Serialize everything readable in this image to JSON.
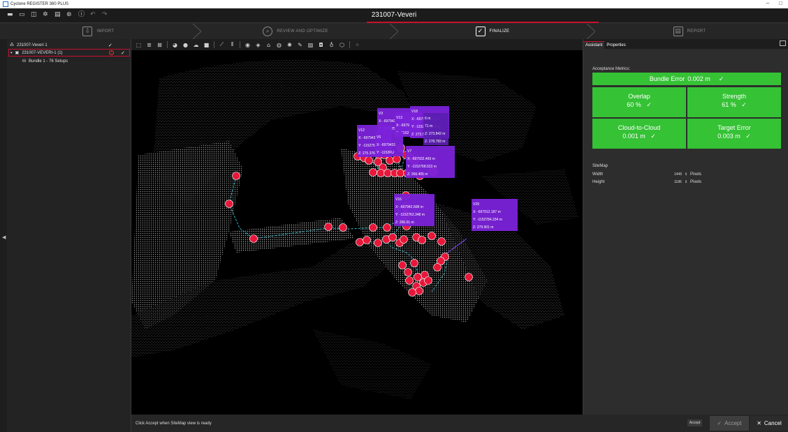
{
  "app": {
    "title": "Cyclone REGISTER 360 PLUS",
    "project_name": "231007-Veveri"
  },
  "window_controls": {
    "minimize": "–",
    "maximize": "□"
  },
  "workflow_steps": [
    {
      "label": "IMPORT",
      "icon": "import-icon",
      "active": false
    },
    {
      "label": "REVIEW AND OPTIMIZE",
      "icon": "search-optimize-icon",
      "active": false
    },
    {
      "label": "FINALIZE",
      "icon": "finalize-check-icon",
      "active": true
    },
    {
      "label": "REPORT",
      "icon": "report-icon",
      "active": false
    }
  ],
  "tree": {
    "root": {
      "label": "231007-Veveri 1",
      "checked": "✓"
    },
    "child": {
      "label": "231007-VEVERI-1 (1)",
      "checked": "✓",
      "warning": "!"
    },
    "bundle": {
      "label": "Bundle 1 - 76 Setups"
    }
  },
  "right_panel": {
    "tabs": [
      "Assistant",
      "Properties"
    ],
    "metrics_label": "Acceptance Metrics:",
    "bundle_error": {
      "label": "Bundle Error",
      "value": "0.002 m",
      "check": "✓"
    },
    "tiles": [
      {
        "label": "Overlap",
        "value": "60 %",
        "check": "✓"
      },
      {
        "label": "Strength",
        "value": "61 %",
        "check": "✓"
      },
      {
        "label": "Cloud-to-Cloud",
        "value": "0.001 m",
        "check": "✓"
      },
      {
        "label": "Target Error",
        "value": "0.003 m",
        "check": "✓"
      }
    ],
    "sitemap_label": "SiteMap",
    "width": {
      "label": "Width",
      "value": "1446",
      "unit": "Pixels"
    },
    "height": {
      "label": "Height",
      "value": "1186",
      "unit": "Pixels"
    },
    "accent_color": "#35c235"
  },
  "status": {
    "message": "Click Accept when SiteMap view is ready"
  },
  "buttons": {
    "accept_small": "Accept",
    "accept": "Accept",
    "accept_icon": "✓",
    "cancel": "Cancel",
    "cancel_icon": "✕"
  },
  "viewport_labels": [
    {
      "id": "V3",
      "lines": [
        "V3",
        "X: -697942",
        "Y: -115275"
      ]
    },
    {
      "id": "V13",
      "lines": [
        "V13",
        "X: -6979",
        "Y: -1152"
      ]
    },
    {
      "id": "V18",
      "lines": [
        "V18",
        "X: -697932.175 m",
        "Y: -1152754.348 m",
        "Z: 273.594 m"
      ]
    },
    {
      "id": "V12",
      "lines": [
        "V12",
        "X: -697943",
        "Y: -115275",
        "Z: 275.376"
      ]
    },
    {
      "id": "V5",
      "lines": [
        "V5",
        "X: -6979431",
        "Y: -1152FU"
      ]
    },
    {
      "id": "V7",
      "lines": [
        "V7",
        "X: -697932.469 m",
        "Y: -1152768.523 m",
        "Z: 266.405 m"
      ]
    },
    {
      "id": "V16",
      "lines": [
        "V16",
        "X: -697942.508 m",
        "Y: -1152762.348 m",
        "Z: 266.01 m"
      ]
    },
    {
      "id": "V29",
      "lines": [
        "V29",
        "X: -697912.187 m",
        "Y: -1152784.234 m",
        "Z: 279.901 m"
      ]
    },
    {
      "id": "extra",
      "lines": [
        "6 m",
        "71 m",
        "Z: 273.842 m",
        "Z: 278.783 m"
      ]
    }
  ],
  "colors": {
    "highlight": "#c8102e",
    "label_bg": "#7b22d9",
    "marker": "#e8173a",
    "link": "#2bb8c8"
  }
}
